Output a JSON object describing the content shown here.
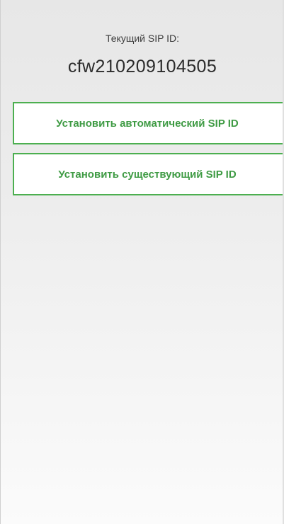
{
  "sip": {
    "label": "Текущий SIP ID:",
    "value": "cfw210209104505"
  },
  "buttons": {
    "auto_label": "Установить автоматический SIP ID",
    "existing_label": "Установить существующий SIP ID"
  },
  "colors": {
    "accent": "#4caf50",
    "button_text": "#3f9b44",
    "background": "#ececec"
  }
}
